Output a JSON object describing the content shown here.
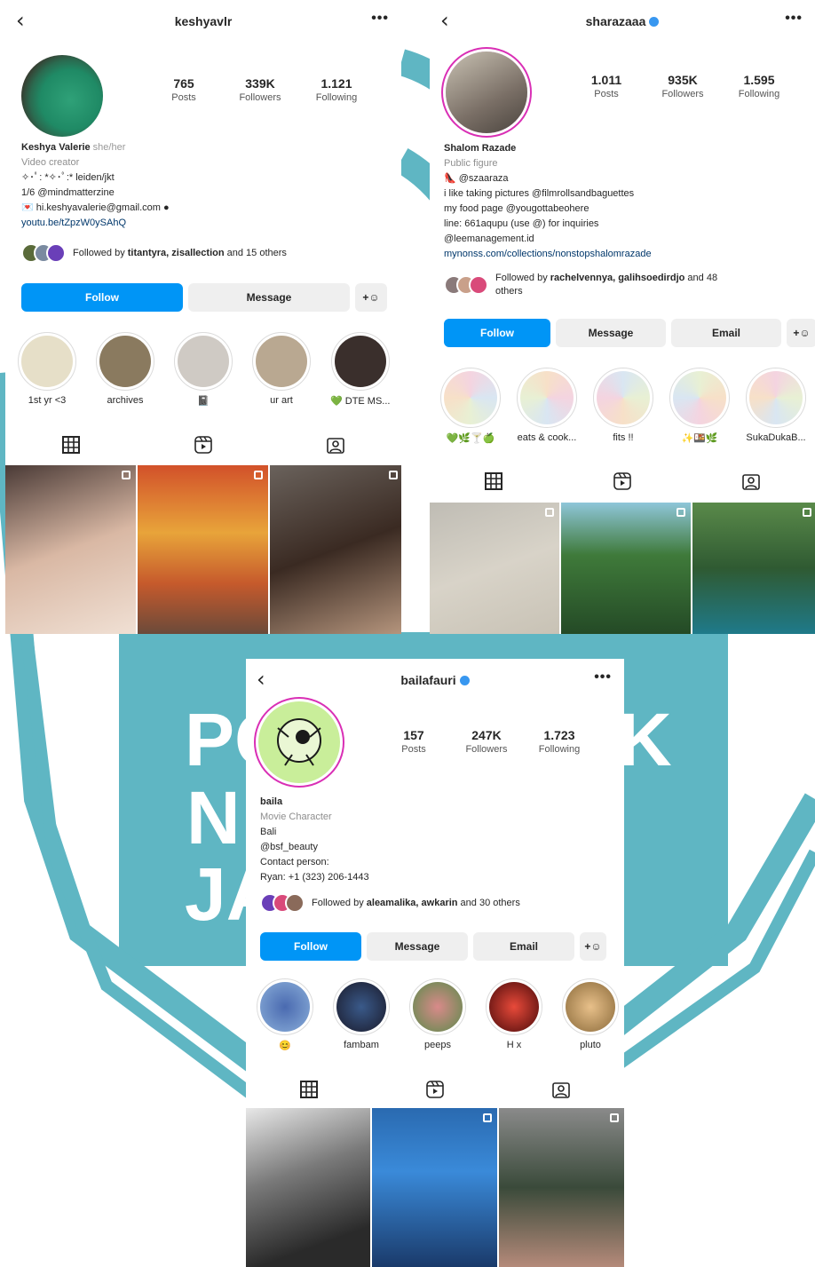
{
  "background": {
    "accent": "#5fb6c3",
    "watermark_lines": [
      "PO",
      "N",
      "JA",
      "K"
    ]
  },
  "profiles": [
    {
      "username": "keshyavlr",
      "verified": false,
      "stats": [
        {
          "num": "765",
          "lbl": "Posts"
        },
        {
          "num": "339K",
          "lbl": "Followers"
        },
        {
          "num": "1.121",
          "lbl": "Following"
        }
      ],
      "bio": {
        "name": "Keshya Valerie",
        "pronouns": "she/her",
        "category": "Video creator",
        "lines": [
          "✧･ﾟ: *✧･ﾟ:* leiden/jkt",
          "1/6 @mindmatterzine",
          "💌 hi.keshyavalerie@gmail.com ●"
        ],
        "link": "youtu.be/tZpzW0ySAhQ"
      },
      "mutual": {
        "prefix": "Followed by ",
        "names": "titantyra, zisallection",
        "suffix": " and 15 others"
      },
      "buttons": [
        "Follow",
        "Message"
      ],
      "highlights": [
        "1st yr <3",
        "archives",
        "📓",
        "ur art",
        "💚 DTE MS..."
      ],
      "tabs": [
        "grid-icon",
        "reels-icon",
        "tagged-icon"
      ]
    },
    {
      "username": "sharazaaa",
      "verified": true,
      "stats": [
        {
          "num": "1.011",
          "lbl": "Posts"
        },
        {
          "num": "935K",
          "lbl": "Followers"
        },
        {
          "num": "1.595",
          "lbl": "Following"
        }
      ],
      "bio": {
        "name": "Shalom Razade",
        "category": "Public figure",
        "lines": [
          "👠 @szaaraza",
          "i like taking pictures @filmrollsandbaguettes",
          "my food page @yougottabeohere",
          "line: 661aqupu (use @) for inquiries",
          "@leemanagement.id"
        ],
        "link": "mynonss.com/collections/nonstopshalomrazade"
      },
      "mutual": {
        "prefix": "Followed by ",
        "names": "rachelvennya, galihsoedirdjo",
        "suffix": " and 48 others"
      },
      "buttons": [
        "Follow",
        "Message",
        "Email"
      ],
      "highlights": [
        "💚🌿🍸🍏",
        "eats & cook...",
        "fits !!",
        "✨🍱🌿",
        "SukaDukaB..."
      ],
      "tabs": [
        "grid-icon",
        "reels-icon",
        "tagged-icon"
      ]
    },
    {
      "username": "bailafauri",
      "verified": true,
      "stats": [
        {
          "num": "157",
          "lbl": "Posts"
        },
        {
          "num": "247K",
          "lbl": "Followers"
        },
        {
          "num": "1.723",
          "lbl": "Following"
        }
      ],
      "bio": {
        "name": "baila",
        "category": "Movie Character",
        "lines": [
          "Bali",
          "@bsf_beauty",
          "Contact person:",
          "Ryan: +1 (323) 206-1443"
        ]
      },
      "mutual": {
        "prefix": "Followed by ",
        "names": "aleamalika, awkarin",
        "suffix": " and 30 others"
      },
      "buttons": [
        "Follow",
        "Message",
        "Email"
      ],
      "highlights": [
        "😊",
        "fambam",
        "peeps",
        "H x",
        "pluto"
      ],
      "tabs": [
        "grid-icon",
        "reels-icon",
        "tagged-icon"
      ]
    }
  ]
}
